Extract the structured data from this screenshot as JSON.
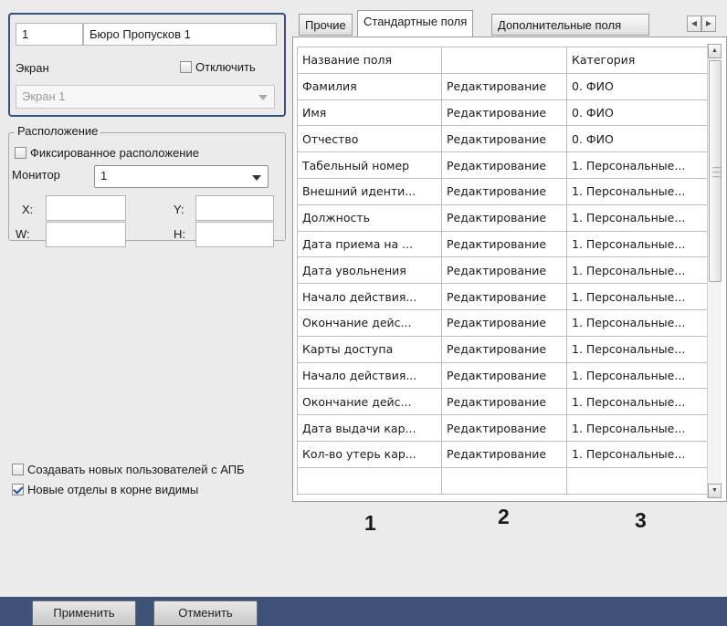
{
  "left_panel": {
    "id_value": "1",
    "name_value": "Бюро Пропусков 1",
    "screen_label": "Экран",
    "disable_label": "Отключить",
    "disable_checked": false,
    "screen_select_value": "Экран 1",
    "location_group_label": "Расположение",
    "fixed_location_label": "Фиксированное расположение",
    "fixed_location_checked": false,
    "monitor_label": "Монитор",
    "monitor_value": "1",
    "x_label": "X:",
    "y_label": "Y:",
    "w_label": "W:",
    "h_label": "H:",
    "x_value": "",
    "y_value": "",
    "w_value": "",
    "h_value": "",
    "create_users_label": "Создавать новых пользователей с АПБ",
    "create_users_checked": false,
    "root_depts_label": "Новые отделы в корне видимы",
    "root_depts_checked": true
  },
  "tabs": [
    {
      "label": "Прочие",
      "active": false
    },
    {
      "label": "Стандартные поля",
      "active": true
    },
    {
      "label": "Дополнительные поля",
      "active": false
    }
  ],
  "grid": {
    "headers": [
      "Название поля",
      "",
      "Категория"
    ],
    "rows": [
      [
        "Фамилия",
        "Редактирование",
        "0. ФИО"
      ],
      [
        "Имя",
        "Редактирование",
        "0. ФИО"
      ],
      [
        "Отчество",
        "Редактирование",
        "0. ФИО"
      ],
      [
        "Табельный номер",
        "Редактирование",
        "1. Персональные..."
      ],
      [
        "Внешний иденти...",
        "Редактирование",
        "1. Персональные..."
      ],
      [
        "Должность",
        "Редактирование",
        "1. Персональные..."
      ],
      [
        "Дата приема на ...",
        "Редактирование",
        "1. Персональные..."
      ],
      [
        "Дата увольнения",
        "Редактирование",
        "1. Персональные..."
      ],
      [
        "Начало действия...",
        "Редактирование",
        "1. Персональные..."
      ],
      [
        "Окончание дейс...",
        "Редактирование",
        "1. Персональные..."
      ],
      [
        "Карты доступа",
        "Редактирование",
        "1. Персональные..."
      ],
      [
        "Начало действия...",
        "Редактирование",
        "1. Персональные..."
      ],
      [
        "Окончание дейс...",
        "Редактирование",
        "1. Персональные..."
      ],
      [
        "Дата выдачи кар...",
        "Редактирование",
        "1. Персональные..."
      ],
      [
        "Кол-во утерь кар...",
        "Редактирование",
        "1. Персональные..."
      ],
      [
        "",
        "",
        ""
      ]
    ]
  },
  "callouts": [
    "1",
    "2",
    "3"
  ],
  "buttons": {
    "apply_label": "Применить",
    "cancel_label": "Отменить"
  },
  "colors": {
    "accent_border": "#3b4f7c",
    "bottom_bar": "#3e5278",
    "panel_bg": "#ebebeb",
    "checkbox_check": "#2a4fa0"
  },
  "icons": {
    "tab_scroll_left": "triangle-left-icon",
    "tab_scroll_right": "triangle-right-icon",
    "scroll_up": "triangle-up-icon",
    "scroll_down": "triangle-down-icon",
    "dropdown": "chevron-down-icon"
  }
}
